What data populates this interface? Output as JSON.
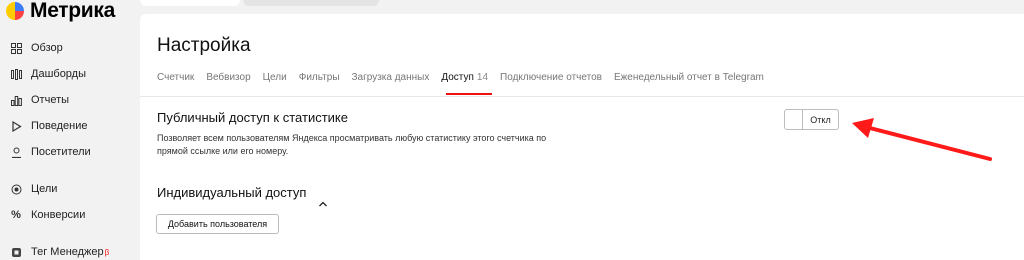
{
  "brand": {
    "name": "Метрика"
  },
  "sidebar": {
    "items": [
      {
        "label": "Обзор",
        "icon": "grid-icon"
      },
      {
        "label": "Дашборды",
        "icon": "dashboard-icon"
      },
      {
        "label": "Отчеты",
        "icon": "bar-chart-icon"
      },
      {
        "label": "Поведение",
        "icon": "play-icon"
      },
      {
        "label": "Посетители",
        "icon": "user-icon"
      },
      {
        "label": "Цели",
        "icon": "target-icon"
      },
      {
        "label": "Конверсии",
        "icon": "percent-icon"
      },
      {
        "label": "Тег Менеджер",
        "icon": "tag-manager-icon",
        "badge": "β"
      }
    ]
  },
  "page": {
    "title": "Настройка",
    "tabs": [
      {
        "label": "Счетчик"
      },
      {
        "label": "Вебвизор"
      },
      {
        "label": "Цели"
      },
      {
        "label": "Фильтры"
      },
      {
        "label": "Загрузка данных"
      },
      {
        "label": "Доступ",
        "count": "14",
        "active": true
      },
      {
        "label": "Подключение отчетов"
      },
      {
        "label": "Еженедельный отчет в Telegram"
      }
    ]
  },
  "public_access": {
    "title": "Публичный доступ к статистике",
    "description": "Позволяет всем пользователям Яндекса просматривать любую статистику этого счетчика по прямой ссылке или его номеру.",
    "toggle_label": "Откл",
    "enabled": false
  },
  "individual_access": {
    "title": "Индивидуальный доступ",
    "add_user_label": "Добавить пользователя"
  },
  "colors": {
    "accent_red": "#ee1111",
    "arrow_red": "#ff1a1a"
  }
}
